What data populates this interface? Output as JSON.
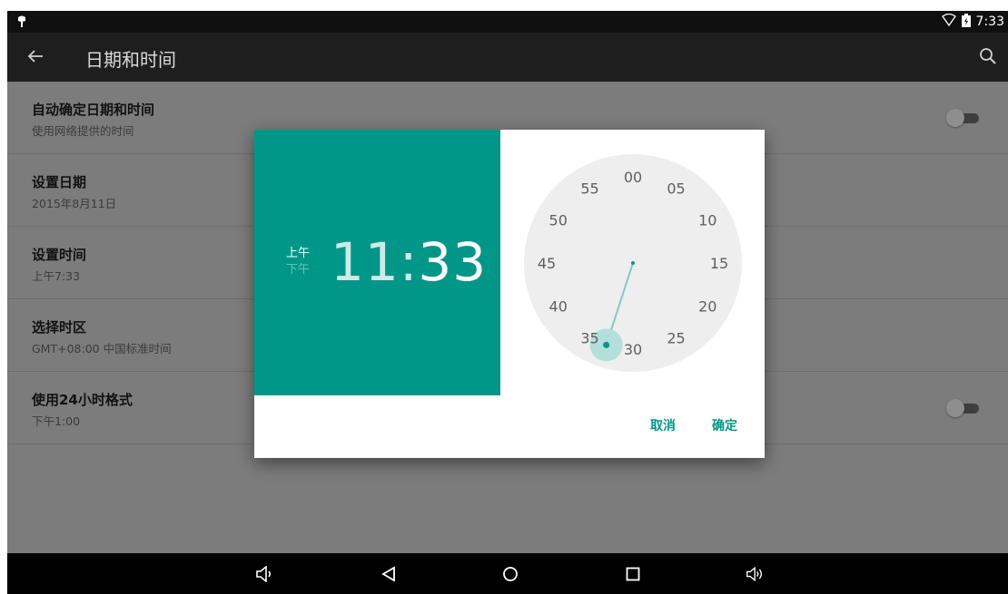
{
  "status_bar": {
    "time": "7:33",
    "icons": [
      "android-debug-icon",
      "wifi-icon",
      "battery-icon"
    ]
  },
  "action_bar": {
    "title": "日期和时间",
    "icons": [
      "back-arrow-icon",
      "search-icon"
    ]
  },
  "settings": [
    {
      "title": "自动确定日期和时间",
      "summary": "使用网络提供的时间",
      "toggle": false
    },
    {
      "title": "设置日期",
      "summary": "2015年8月11日"
    },
    {
      "title": "设置时间",
      "summary": "上午7:33"
    },
    {
      "title": "选择时区",
      "summary": "GMT+08:00 中国标准时间"
    },
    {
      "title": "使用24小时格式",
      "summary": "下午1:00",
      "toggle": false
    }
  ],
  "dialog": {
    "am_label": "上午",
    "pm_label": "下午",
    "selected_period": "上午",
    "hour": "11",
    "separator": ":",
    "minute": "33",
    "clock_numbers": [
      "00",
      "05",
      "10",
      "15",
      "20",
      "25",
      "30",
      "35",
      "40",
      "45",
      "50",
      "55"
    ],
    "selected_minute_value": 33,
    "cancel_label": "取消",
    "ok_label": "确定"
  },
  "nav_bar": {
    "icons": [
      "volume-down-icon",
      "back-icon",
      "home-icon",
      "recents-icon",
      "volume-up-icon"
    ]
  },
  "colors": {
    "accent": "#009788",
    "dim_overlay": "#7c7c7c"
  }
}
